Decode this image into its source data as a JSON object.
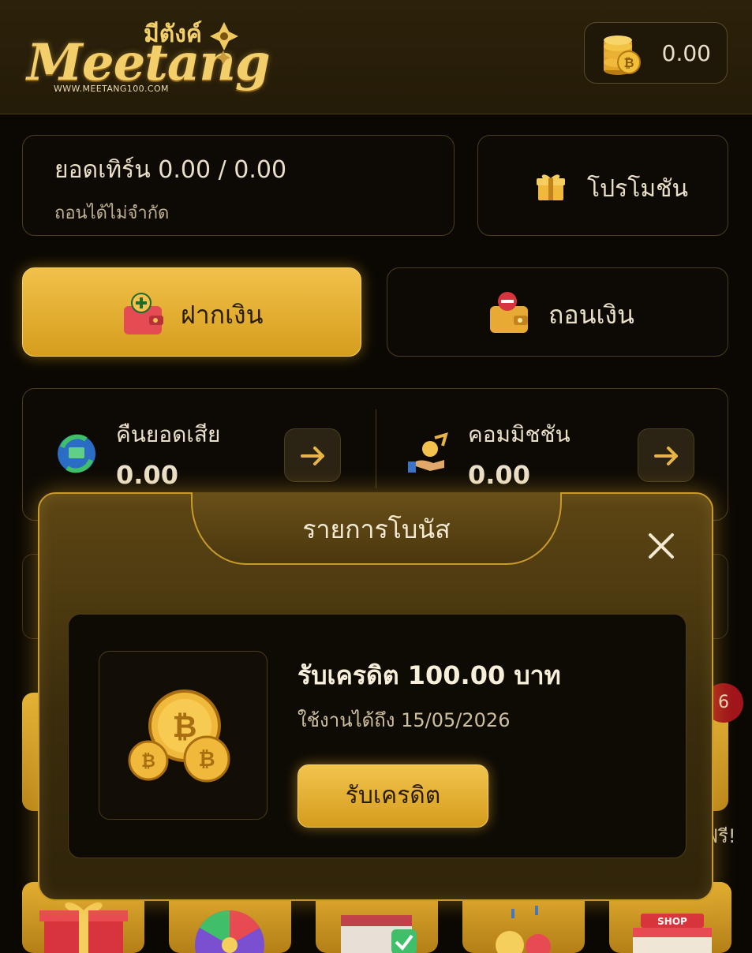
{
  "header": {
    "logo_text": "Meetang",
    "logo_thai": "มีตังค์",
    "logo_url": "WWW.MEETANG100.COM",
    "wallet_balance": "0.00",
    "wallet_icon": "bitcoin-coins-icon"
  },
  "turnover": {
    "label": "ยอดเทิร์น   0.00 / 0.00",
    "sub": "ถอนได้ไม่จำกัด"
  },
  "promo": {
    "label": "โปรโมชัน",
    "icon": "gift-icon"
  },
  "deposit": {
    "label": "ฝากเงิน",
    "icon": "wallet-plus-icon"
  },
  "withdraw": {
    "label": "ถอนเงิน",
    "icon": "wallet-minus-icon"
  },
  "stats": {
    "cashback": {
      "label": "คืนยอดเสีย",
      "value": "0.00",
      "icon": "cashback-icon"
    },
    "commission": {
      "label": "คอมมิชชัน",
      "value": "0.00",
      "icon": "commission-icon"
    }
  },
  "background": {
    "badge": "6",
    "peek_text": "ฟรี!"
  },
  "modal": {
    "title": "รายการโบนัส",
    "bonus_title": "รับเครดิต 100.00 บาท",
    "bonus_expiry": "ใช้งานได้ถึง  15/05/2026",
    "claim_label": "รับเครดิต"
  },
  "colors": {
    "gold": "#e9b53a",
    "background": "#0b0803",
    "text": "#eadfc8"
  }
}
